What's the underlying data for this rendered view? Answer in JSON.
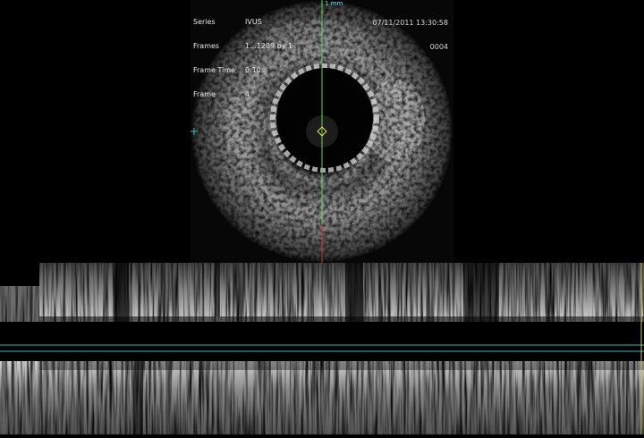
{
  "overlay": {
    "series_label": "Series",
    "series_value": "IVUS",
    "frames_label": "Frames",
    "frames_value": "1...1209 by 1",
    "frame_time_label": "Frame Time",
    "frame_time_value": "0.10s",
    "frame_label": "Frame",
    "frame_value": "4",
    "datetime": "07/11/2011 13:30:58",
    "image_number": "0004",
    "scale_label": "1 mm"
  },
  "colors": {
    "background": "#000000",
    "crosshair_vertical": "#5fd65a",
    "crosshair_marker": "#e0e060",
    "cursor_line": "#36b6be",
    "lower_cursor_tick": "#d03030",
    "scale_label": "#6fe0ee"
  },
  "icons": {
    "catheter_center": "diamond-marker-icon",
    "left_edge_tick": "cross-tick-icon"
  }
}
